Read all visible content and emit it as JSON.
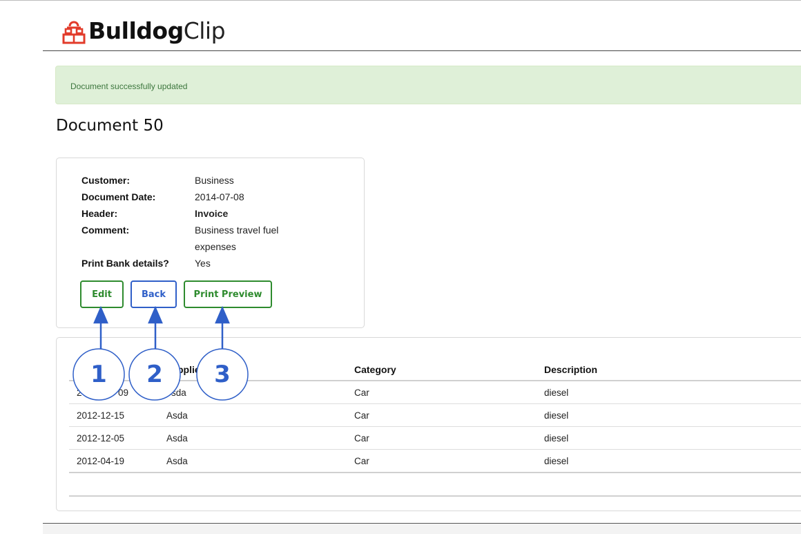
{
  "brand": {
    "bold": "Bulldog",
    "light": "Clip",
    "icon": "bulldog-clip-icon",
    "icon_color": "#e23b2a"
  },
  "alert": {
    "message": "Document successfully updated",
    "bg_color": "#dff0d8",
    "text_color": "#3c763d"
  },
  "page_title": "Document 50",
  "details": [
    {
      "label": "Customer:",
      "value": "Business"
    },
    {
      "label": "Document Date:",
      "value": "2014-07-08"
    },
    {
      "label": "Header:",
      "value": "Invoice"
    },
    {
      "label": "Comment:",
      "value": "Business travel fuel expenses"
    },
    {
      "label": "Print Bank details?",
      "value": "Yes"
    }
  ],
  "actions": {
    "edit": "Edit",
    "back": "Back",
    "print_preview": "Print Preview",
    "green": "#2e8b2e",
    "blue": "#2f5fc8"
  },
  "table": {
    "headers": {
      "date": "",
      "supplier": "pplie",
      "category": "Category",
      "description": "Description"
    },
    "rows": [
      {
        "date": "2",
        "date_tail": "09",
        "supplier": "sda",
        "category": "Car",
        "description": "diesel"
      },
      {
        "date": "2012-12-15",
        "supplier": "Asda",
        "category": "Car",
        "description": "diesel"
      },
      {
        "date": "2012-12-05",
        "supplier": "Asda",
        "category": "Car",
        "description": "diesel"
      },
      {
        "date": "2012-04-19",
        "supplier": "Asda",
        "category": "Car",
        "description": "diesel"
      }
    ]
  },
  "callouts": [
    "1",
    "2",
    "3"
  ]
}
